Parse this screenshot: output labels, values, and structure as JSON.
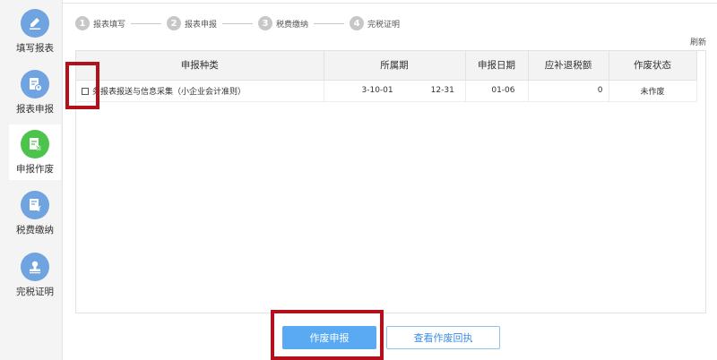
{
  "sidebar": {
    "items": [
      {
        "label": "填写报表",
        "icon": "pen-icon"
      },
      {
        "label": "报表申报",
        "icon": "report-upload-icon"
      },
      {
        "label": "申报作废",
        "icon": "document-void-icon"
      },
      {
        "label": "税费缴纳",
        "icon": "tax-payment-icon"
      },
      {
        "label": "完税证明",
        "icon": "stamp-icon"
      }
    ],
    "active_index": 2
  },
  "steps": [
    {
      "num": "1",
      "label": "报表填写"
    },
    {
      "num": "2",
      "label": "报表申报"
    },
    {
      "num": "3",
      "label": "税费缴纳"
    },
    {
      "num": "4",
      "label": "完税证明"
    }
  ],
  "refresh_label": "刷新",
  "table": {
    "headers": [
      "申报种类",
      "所属期",
      "申报日期",
      "应补退税额",
      "作废状态"
    ],
    "rows": [
      {
        "type": "务报表报送与信息采集（小企业会计准则）",
        "period_start": "3-10-01",
        "period_end": "12-31",
        "date": "01-06",
        "amount": "0",
        "status": "未作废"
      }
    ]
  },
  "buttons": {
    "void": "作废申报",
    "receipt": "查看作废回执"
  },
  "colors": {
    "primary": "#59aaf2",
    "active_icon": "#4cc44c",
    "icon": "#6fa4e0",
    "highlight": "#b3101b"
  }
}
